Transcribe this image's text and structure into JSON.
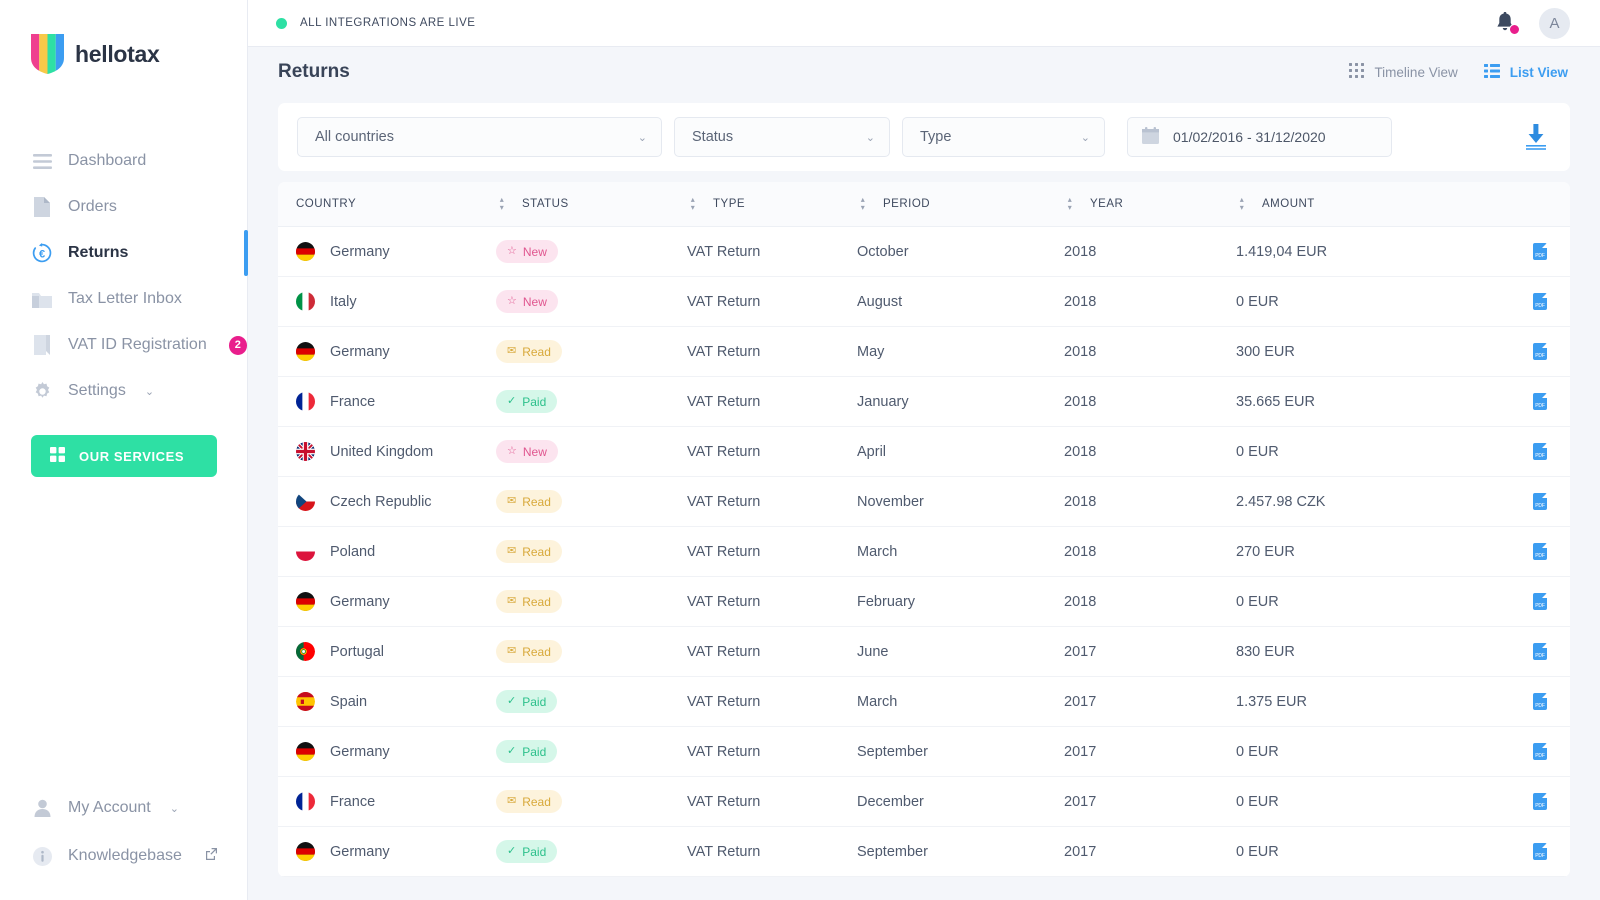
{
  "brand": {
    "name": "hellotax"
  },
  "sidebar": {
    "items": [
      {
        "label": "Dashboard",
        "icon": "menu-icon",
        "active": false
      },
      {
        "label": "Orders",
        "icon": "document-icon",
        "active": false
      },
      {
        "label": "Returns",
        "icon": "euro-refresh-icon",
        "active": true
      },
      {
        "label": "Tax Letter Inbox",
        "icon": "folder-icon",
        "active": false
      },
      {
        "label": "VAT ID Registration",
        "icon": "bookmark-icon",
        "active": false,
        "badge": "2"
      },
      {
        "label": "Settings",
        "icon": "gear-icon",
        "active": false,
        "chevron": "⌄"
      }
    ],
    "services_button": {
      "label": "OUR SERVICES",
      "icon": "grid-icon",
      "color": "#2ee0a4"
    },
    "bottom_items": [
      {
        "label": "My Account",
        "icon": "user-icon",
        "chevron": "⌄"
      },
      {
        "label": "Knowledgebase",
        "icon": "info-icon",
        "external": true
      }
    ]
  },
  "topbar": {
    "status_text": "ALL INTEGRATIONS ARE LIVE",
    "status_color": "#2ee0a4",
    "notification_icon": "bell-icon",
    "notification_dot_color": "#e91e8c",
    "avatar_initial": "A"
  },
  "header": {
    "title": "Returns",
    "views": [
      {
        "label": "Timeline View",
        "icon": "grid-view-icon",
        "active": false
      },
      {
        "label": "List View",
        "icon": "list-view-icon",
        "active": true
      }
    ],
    "accent_color": "#3c9df1"
  },
  "filters": {
    "country": {
      "value": "All countries",
      "chevron": "⌄"
    },
    "status": {
      "value": "Status",
      "chevron": "⌄"
    },
    "type": {
      "value": "Type",
      "chevron": "⌄"
    },
    "daterange": {
      "value": "01/02/2016 - 31/12/2020",
      "icon": "calendar-icon"
    },
    "download": {
      "icon": "download-icon",
      "color": "#3c9df1"
    }
  },
  "table": {
    "columns": [
      "COUNTRY",
      "STATUS",
      "TYPE",
      "PERIOD",
      "YEAR",
      "AMOUNT"
    ],
    "rows": [
      {
        "country": "Germany",
        "flag": "de",
        "status": "New",
        "type": "VAT Return",
        "period": "October",
        "year": "2018",
        "amount": "1.419,04 EUR",
        "file": "pdf-icon"
      },
      {
        "country": "Italy",
        "flag": "it",
        "status": "New",
        "type": "VAT Return",
        "period": "August",
        "year": "2018",
        "amount": "0 EUR",
        "file": "pdf-icon"
      },
      {
        "country": "Germany",
        "flag": "de",
        "status": "Read",
        "type": "VAT Return",
        "period": "May",
        "year": "2018",
        "amount": "300 EUR",
        "file": "pdf-icon"
      },
      {
        "country": "France",
        "flag": "fr",
        "status": "Paid",
        "type": "VAT Return",
        "period": "January",
        "year": "2018",
        "amount": "35.665 EUR",
        "file": "pdf-icon"
      },
      {
        "country": "United Kingdom",
        "flag": "gb",
        "status": "New",
        "type": "VAT Return",
        "period": "April",
        "year": "2018",
        "amount": "0 EUR",
        "file": "pdf-icon"
      },
      {
        "country": "Czech Republic",
        "flag": "cz",
        "status": "Read",
        "type": "VAT Return",
        "period": "November",
        "year": "2018",
        "amount": "2.457.98 CZK",
        "file": "pdf-icon"
      },
      {
        "country": "Poland",
        "flag": "pl",
        "status": "Read",
        "type": "VAT Return",
        "period": "March",
        "year": "2018",
        "amount": "270 EUR",
        "file": "pdf-icon"
      },
      {
        "country": "Germany",
        "flag": "de",
        "status": "Read",
        "type": "VAT Return",
        "period": "February",
        "year": "2018",
        "amount": "0 EUR",
        "file": "pdf-icon"
      },
      {
        "country": "Portugal",
        "flag": "pt",
        "status": "Read",
        "type": "VAT Return",
        "period": "June",
        "year": "2017",
        "amount": "830 EUR",
        "file": "pdf-icon"
      },
      {
        "country": "Spain",
        "flag": "es",
        "status": "Paid",
        "type": "VAT Return",
        "period": "March",
        "year": "2017",
        "amount": "1.375 EUR",
        "file": "pdf-icon"
      },
      {
        "country": "Germany",
        "flag": "de",
        "status": "Paid",
        "type": "VAT Return",
        "period": "September",
        "year": "2017",
        "amount": "0 EUR",
        "file": "pdf-icon"
      },
      {
        "country": "France",
        "flag": "fr",
        "status": "Read",
        "type": "VAT Return",
        "period": "December",
        "year": "2017",
        "amount": "0 EUR",
        "file": "pdf-icon"
      },
      {
        "country": "Germany",
        "flag": "de",
        "status": "Paid",
        "type": "VAT Return",
        "period": "September",
        "year": "2017",
        "amount": "0 EUR",
        "file": "pdf-icon"
      }
    ],
    "status_styles": {
      "New": {
        "bg": "#fce4ef",
        "fg": "#e0568f",
        "icon": "star-icon"
      },
      "Read": {
        "bg": "#fdf3dc",
        "fg": "#d8a93b",
        "icon": "envelope-icon"
      },
      "Paid": {
        "bg": "#d5f7e9",
        "fg": "#2cc08b",
        "icon": "check-icon"
      }
    }
  }
}
